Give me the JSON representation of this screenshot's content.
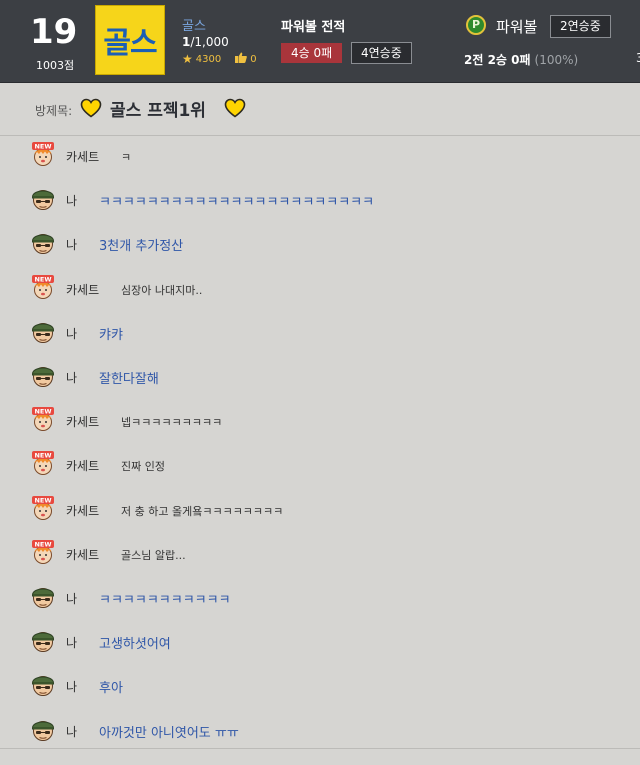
{
  "header": {
    "level": "19",
    "points": "1003점",
    "logo_text": "골스",
    "user": {
      "name": "골스",
      "rank_current": "1",
      "rank_total": "/1,000",
      "stars": "4300",
      "likes": "0"
    },
    "powerball_record_title": "파워볼 전적",
    "record_badge": "4승 0패",
    "streak_badge": "4연승중",
    "powerball_icon": "P",
    "powerball_name": "파워볼",
    "powerball_streak": "2연승중",
    "overall_record": "2전 2승 0패",
    "overall_pct": "(100%)",
    "edge_text": "3"
  },
  "room": {
    "label": "방제목:",
    "title": "골스 프젝1위"
  },
  "colors": {
    "header_bg": "#3c3f44",
    "page_bg": "#d6d5d2",
    "my_message": "#2f56a8",
    "logo_bg": "#f6d51a",
    "logo_text": "#1b5fb5",
    "record_badge": "#a9353b"
  },
  "messages": [
    {
      "sender": "카세트",
      "text": "ㅋ",
      "mine": false
    },
    {
      "sender": "나",
      "text": "ㅋㅋㅋㅋㅋㅋㅋㅋㅋㅋㅋㅋㅋㅋㅋㅋㅋㅋㅋㅋㅋㅋㅋ",
      "mine": true
    },
    {
      "sender": "나",
      "text": "3천개 추가정산",
      "mine": true
    },
    {
      "sender": "카세트",
      "text": "심장아 나대지마..",
      "mine": false
    },
    {
      "sender": "나",
      "text": "캬캬",
      "mine": true
    },
    {
      "sender": "나",
      "text": "잘한다잘해",
      "mine": true
    },
    {
      "sender": "카세트",
      "text": "넵ㅋㅋㅋㅋㅋㅋㅋㅋㅋ",
      "mine": false
    },
    {
      "sender": "카세트",
      "text": "진짜 인정",
      "mine": false
    },
    {
      "sender": "카세트",
      "text": "저 충 하고 올게욬ㅋㅋㅋㅋㅋㅋㅋㅋ",
      "mine": false
    },
    {
      "sender": "카세트",
      "text": "골스님 알랍...",
      "mine": false
    },
    {
      "sender": "나",
      "text": "ㅋㅋㅋㅋㅋㅋㅋㅋㅋㅋㅋ",
      "mine": true
    },
    {
      "sender": "나",
      "text": "고생하셧어여",
      "mine": true
    },
    {
      "sender": "나",
      "text": "후아",
      "mine": true
    },
    {
      "sender": "나",
      "text": "아까것만 아니엿어도 ㅠㅠ",
      "mine": true
    }
  ]
}
